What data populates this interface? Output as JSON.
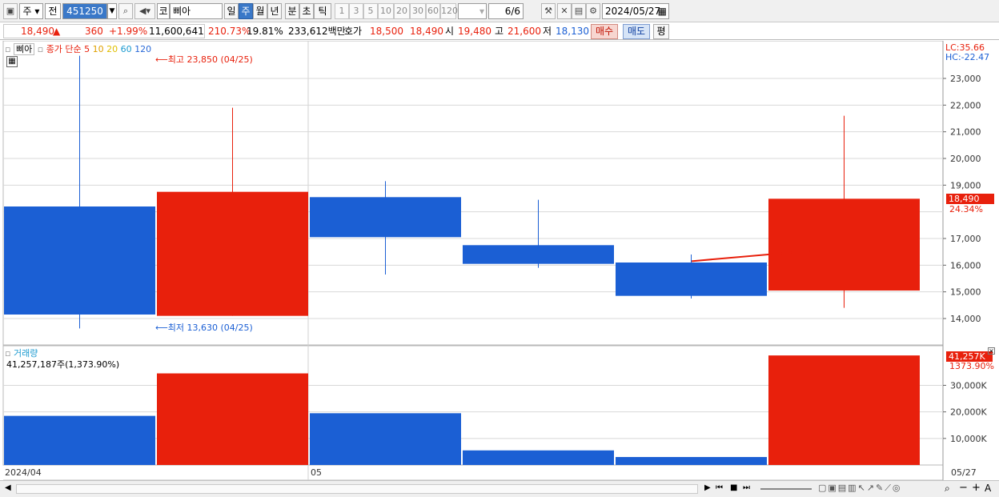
{
  "toolbar": {
    "period_label": "주",
    "prev_label": "전",
    "code": "451250",
    "market_badge": "코",
    "name": "삐아",
    "periods": [
      "일",
      "주",
      "월",
      "년",
      "분",
      "초",
      "틱"
    ],
    "selected_period": "주",
    "intervals": [
      "1",
      "3",
      "5",
      "10",
      "20",
      "30",
      "60",
      "120"
    ],
    "page": "6/6",
    "date": "2024/05/27"
  },
  "quote": {
    "price": "18,490",
    "change_arrow": "▲",
    "change": "360",
    "change_pct": "+1.99%",
    "volume": "11,600,641",
    "volume_ratio": "210.73%",
    "turnover": "19.81%",
    "amount": "233,612백만",
    "ask_label": "호가",
    "ask": "18,500",
    "bid": "18,490",
    "open_label": "시",
    "open": "19,480",
    "high_label": "고",
    "high": "21,600",
    "low_label": "저",
    "low": "18,130",
    "buy_label": "매수",
    "sell_label": "매도",
    "avg_label": "평"
  },
  "legend": {
    "name": "삐아",
    "ma_label": "종가 단순",
    "ma": [
      "5",
      "10",
      "20",
      "60",
      "120"
    ],
    "ma_colors": [
      "#e8200c",
      "#e0a000",
      "#e0c000",
      "#1b9ad0",
      "#2a6ad8"
    ]
  },
  "price_panel": {
    "lc": "LC:35.66",
    "hc": "HC:-22.47",
    "high_mark": "최고 23,850 (04/25)",
    "low_mark": "최저 13,630 (04/25)",
    "current_tag": "18,490",
    "current_pct": "24.34%",
    "ticks": [
      "23,000",
      "22,000",
      "21,000",
      "20,000",
      "19,000",
      "17,000",
      "16,000",
      "15,000",
      "14,000"
    ]
  },
  "volume_panel": {
    "title": "거래량",
    "summary": "41,257,187주(1,373.90%)",
    "current_tag": "41,257K",
    "current_pct": "1373.90%",
    "ticks": [
      "30,000K",
      "20,000K",
      "10,000K"
    ]
  },
  "xaxis": {
    "left": "2024/04",
    "mid": "05",
    "right": "05/27"
  },
  "colors": {
    "up": "#e8200c",
    "down": "#1b5fd4",
    "grid": "#d8d8d8"
  },
  "chart_data": {
    "type": "candlestick",
    "y_min": 13300,
    "y_max": 24200,
    "candles": [
      {
        "open": 18200,
        "close": 14150,
        "high": 23850,
        "low": 13630,
        "dir": "down"
      },
      {
        "open": 14100,
        "close": 18750,
        "high": 21900,
        "low": 14100,
        "dir": "up"
      },
      {
        "open": 18550,
        "close": 17050,
        "high": 19150,
        "low": 15650,
        "dir": "down"
      },
      {
        "open": 16750,
        "close": 16050,
        "high": 18450,
        "low": 15900,
        "dir": "down"
      },
      {
        "open": 16100,
        "close": 14850,
        "high": 16400,
        "low": 14750,
        "dir": "down"
      },
      {
        "open": 15050,
        "close": 18490,
        "high": 21600,
        "low": 14400,
        "dir": "up"
      }
    ],
    "ma5": [
      null,
      null,
      null,
      null,
      16150,
      16650
    ],
    "volume": {
      "y_max": 41257,
      "values": [
        18500,
        34500,
        19500,
        5500,
        3000,
        41257
      ],
      "dir": [
        "down",
        "up",
        "down",
        "down",
        "down",
        "up"
      ]
    }
  }
}
